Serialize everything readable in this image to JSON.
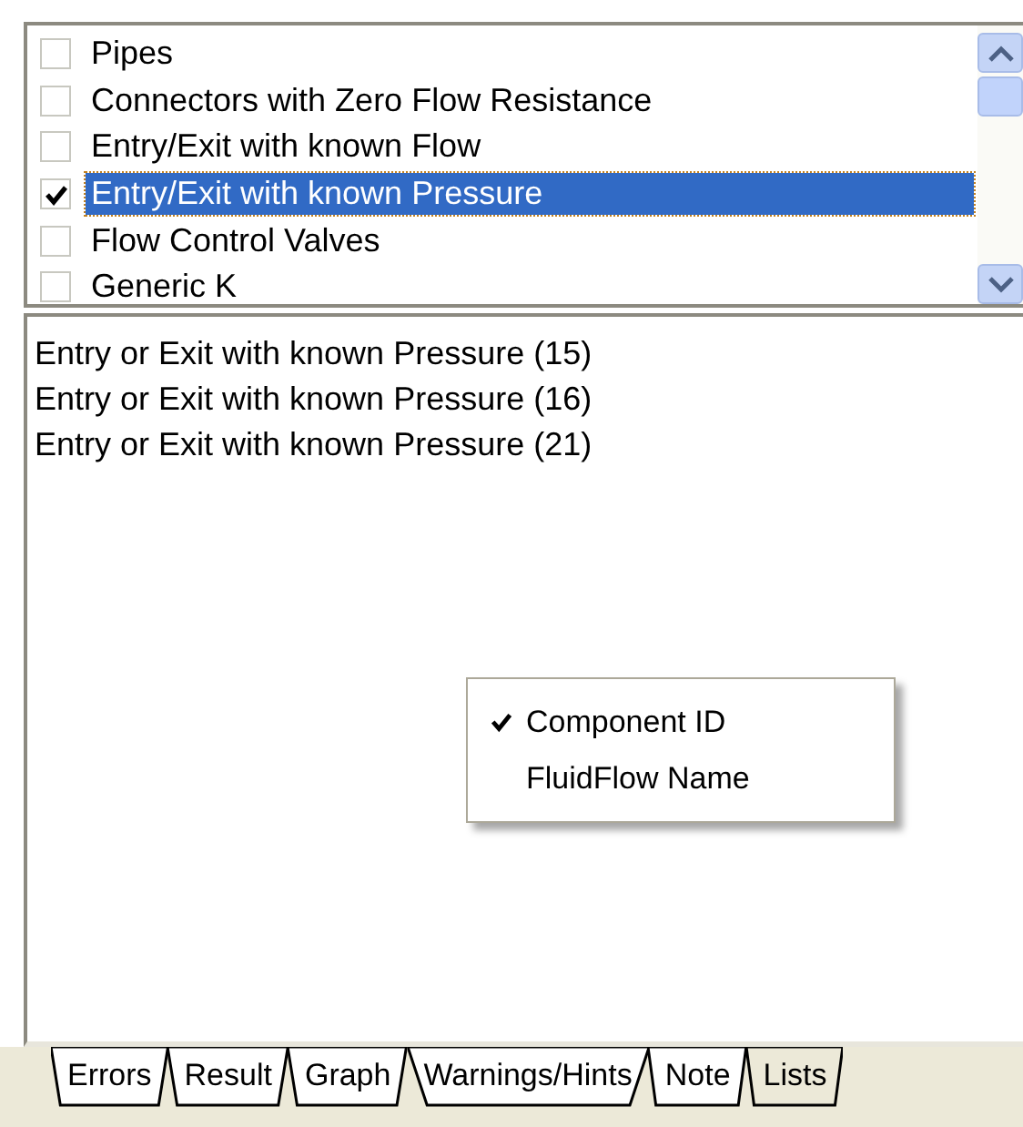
{
  "checklist": {
    "items": [
      {
        "label": "Pipes",
        "checked": false,
        "selected": false
      },
      {
        "label": "Connectors with Zero Flow Resistance",
        "checked": false,
        "selected": false
      },
      {
        "label": "Entry/Exit with known Flow",
        "checked": false,
        "selected": false
      },
      {
        "label": "Entry/Exit with known Pressure",
        "checked": true,
        "selected": true
      },
      {
        "label": "Flow Control Valves",
        "checked": false,
        "selected": false
      },
      {
        "label": "Generic K",
        "checked": false,
        "selected": false
      }
    ]
  },
  "results": [
    "Entry or Exit with known Pressure (15)",
    "Entry or Exit with known Pressure (16)",
    "Entry or Exit with known Pressure (21)"
  ],
  "context_menu": {
    "items": [
      {
        "label": "Component ID",
        "checked": true
      },
      {
        "label": "FluidFlow Name",
        "checked": false
      }
    ]
  },
  "tabs": [
    {
      "label": "Errors",
      "selected": false
    },
    {
      "label": "Result",
      "selected": false
    },
    {
      "label": "Graph",
      "selected": false
    },
    {
      "label": "Warnings/Hints",
      "selected": false
    },
    {
      "label": "Note",
      "selected": false
    },
    {
      "label": "Lists",
      "selected": true
    }
  ]
}
